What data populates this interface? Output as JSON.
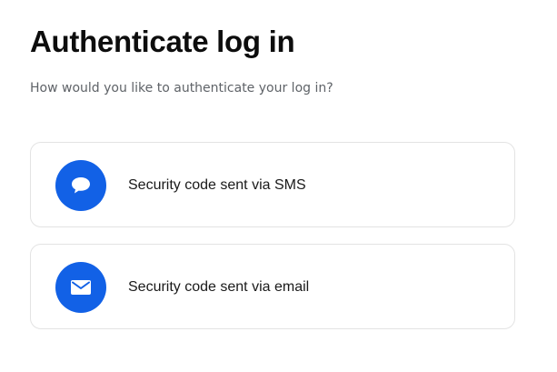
{
  "page": {
    "title": "Authenticate log in",
    "subtitle": "How would you like to authenticate your log in?"
  },
  "options": [
    {
      "label": "Security code sent via SMS",
      "icon": "chat-bubble-icon"
    },
    {
      "label": "Security code sent via email",
      "icon": "envelope-icon"
    }
  ],
  "colors": {
    "accent": "#1261e6",
    "card_border": "#e3e3e3",
    "subtitle_text": "#5f6368",
    "title_text": "#0d0d0d"
  }
}
